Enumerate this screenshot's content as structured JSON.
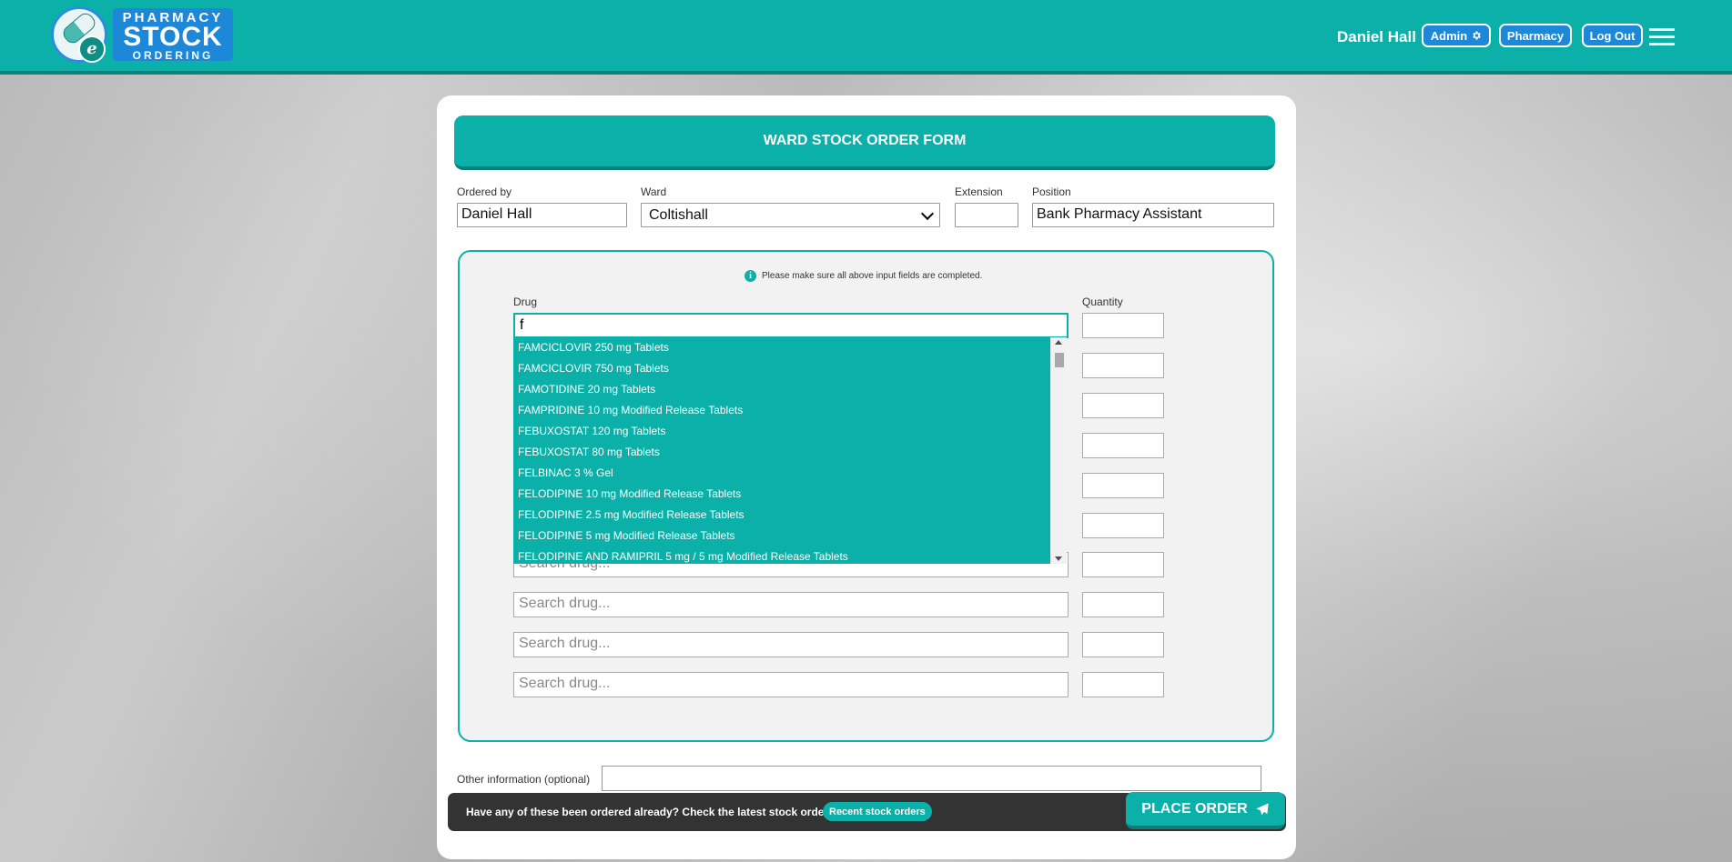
{
  "header": {
    "logo": {
      "line1": "PHARMACY",
      "line2": "STOCK",
      "line3": "ORDERING",
      "badge": "e"
    },
    "user_name": "Daniel Hall",
    "admin_label": "Admin",
    "pharmacy_label": "Pharmacy",
    "logout_label": "Log Out"
  },
  "form": {
    "title": "WARD STOCK ORDER FORM",
    "ordered_by": {
      "label": "Ordered by",
      "value": "Daniel Hall"
    },
    "ward": {
      "label": "Ward",
      "value": "Coltishall"
    },
    "extension": {
      "label": "Extension",
      "value": ""
    },
    "position": {
      "label": "Position",
      "value": "Bank Pharmacy Assistant"
    },
    "notice": "Please make sure all above input fields are completed.",
    "drug_label": "Drug",
    "quantity_label": "Quantity",
    "active_drug_value": "f",
    "drug_placeholder": "Search drug...",
    "dropdown_options": [
      "FAMCICLOVIR 250 mg Tablets",
      "FAMCICLOVIR 750 mg Tablets",
      "FAMOTIDINE 20 mg Tablets",
      "FAMPRIDINE 10 mg Modified Release Tablets",
      "FEBUXOSTAT 120 mg Tablets",
      "FEBUXOSTAT 80 mg Tablets",
      "FELBINAC 3 % Gel",
      "FELODIPINE 10 mg Modified Release Tablets",
      "FELODIPINE 2.5 mg Modified Release Tablets",
      "FELODIPINE 5 mg Modified Release Tablets",
      "FELODIPINE AND RAMIPRIL 5 mg / 5 mg Modified Release Tablets"
    ],
    "other_info_label": "Other information (optional)",
    "other_info_value": ""
  },
  "footer": {
    "check_text": "Have any of these been ordered already? Check the latest stock orders.",
    "recent_label": "Recent stock orders",
    "place_order_label": "PLACE ORDER"
  },
  "colors": {
    "teal": "#0bb0a8",
    "blue": "#1e88d8",
    "dark": "#333333"
  }
}
